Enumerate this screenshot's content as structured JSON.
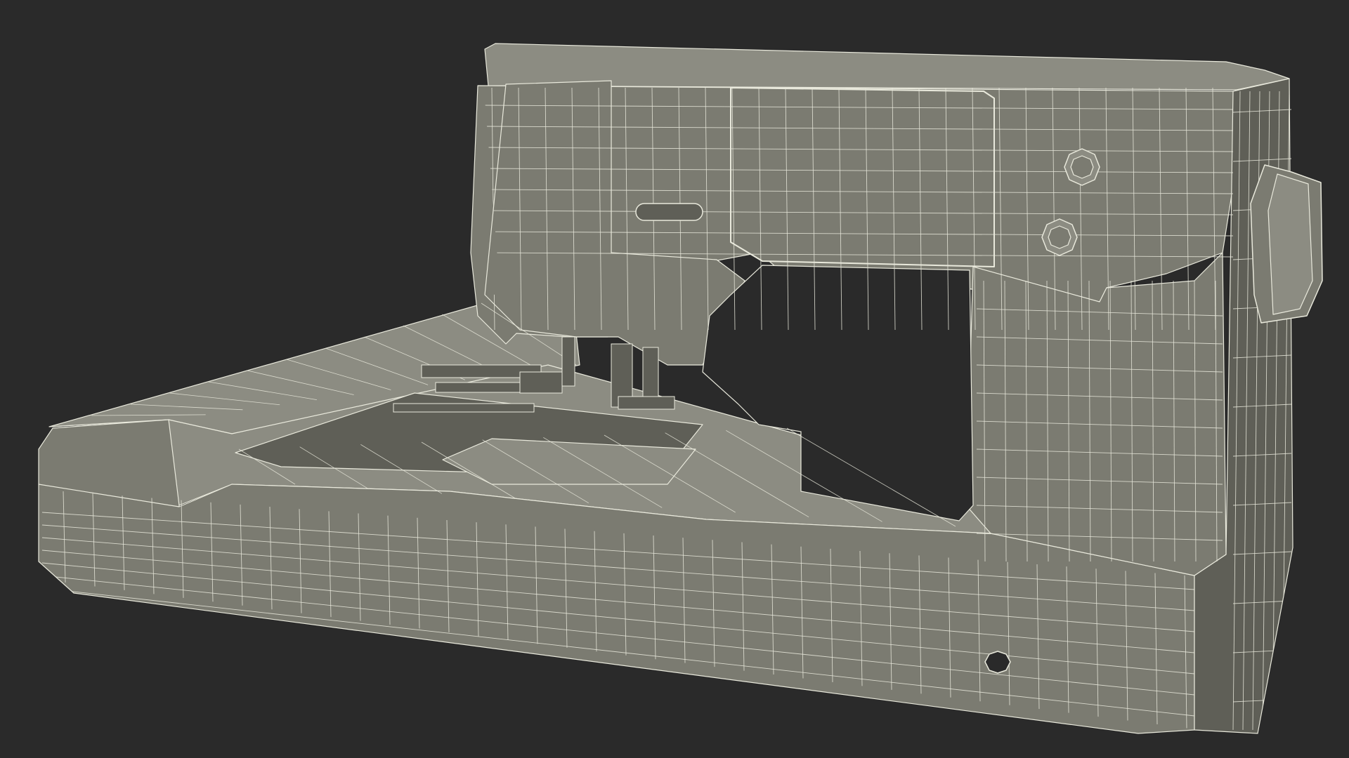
{
  "scene": {
    "subject": "sewing-machine-wireframe",
    "background_color": "#2a2a2a",
    "surface_color": "#7b7b71",
    "surface_shadow_color": "#5f5f57",
    "surface_light_color": "#8c8c82",
    "wire_color": "#e9e9dc",
    "cutout_color": "#2a2a2a"
  }
}
